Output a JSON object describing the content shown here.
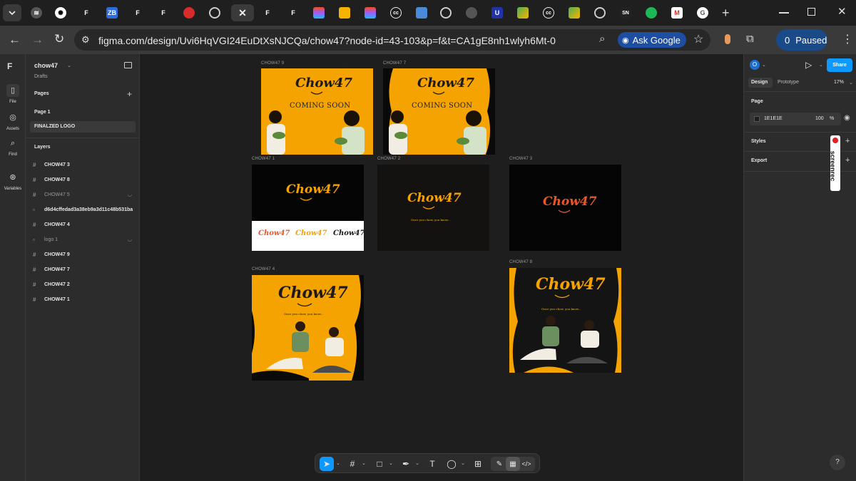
{
  "browser": {
    "url": "figma.com/design/Uvi6HqVGI24EuDtXsNJCQa/chow47?node-id=43-103&p=f&t=CA1gE8nh1wlyh6Mt-0",
    "ask_google_label": "Ask Google",
    "profile_initial": "0",
    "profile_status": "Paused",
    "new_tab": "+",
    "tab_texts": {
      "sn": "SN",
      "u": "U",
      "g": "G"
    }
  },
  "rail": {
    "file_label": "File",
    "assets_label": "Assets",
    "find_label": "Find",
    "variables_label": "Variables"
  },
  "file": {
    "name": "chow47",
    "location": "Drafts"
  },
  "pages": {
    "heading": "Pages",
    "items": [
      "Page 1",
      "FINALZED LOGO"
    ],
    "selected": "FINALZED LOGO"
  },
  "layers": {
    "heading": "Layers",
    "items": [
      {
        "name": "CHOW47 3",
        "icon": "frame-icon",
        "dim": false
      },
      {
        "name": "CHOW47 8",
        "icon": "frame-icon",
        "dim": false
      },
      {
        "name": "CHOW47 5",
        "icon": "frame-icon",
        "dim": true
      },
      {
        "name": "d6d4cffedad3a38eb9a3d11c48b531ba",
        "icon": "image-icon",
        "dim": false
      },
      {
        "name": "CHOW47 4",
        "icon": "frame-icon",
        "dim": false
      },
      {
        "name": "logo 1",
        "icon": "image-icon",
        "dim": true
      },
      {
        "name": "CHOW47 9",
        "icon": "frame-icon",
        "dim": false
      },
      {
        "name": "CHOW47 7",
        "icon": "frame-icon",
        "dim": false
      },
      {
        "name": "CHOW47 2",
        "icon": "frame-icon",
        "dim": false
      },
      {
        "name": "CHOW47 1",
        "icon": "frame-icon",
        "dim": false
      }
    ]
  },
  "canvas": {
    "frames": {
      "f9": {
        "label": "CHOW47 9",
        "logo": "Chow47",
        "subtitle": "COMING SOON"
      },
      "f7": {
        "label": "CHOW47 7",
        "logo": "Chow47",
        "subtitle": "COMING SOON"
      },
      "f1": {
        "label": "CHOW47 1",
        "logo": "Chow47",
        "variants": [
          "Chow47",
          "Chow47",
          "Chow47"
        ]
      },
      "f2": {
        "label": "CHOW47 2",
        "logo": "Chow47",
        "tagline": "Once you chow, you know..."
      },
      "f3": {
        "label": "CHOW47 3",
        "logo": "Chow47"
      },
      "f4": {
        "label": "CHOW47 4",
        "logo": "Chow47",
        "tagline": "Once you chow, you know..."
      },
      "f8": {
        "label": "CHOW47 8",
        "logo": "Chow47",
        "tagline": "Once you chow, you know..."
      }
    }
  },
  "props": {
    "avatar_initial": "O",
    "share_label": "Share",
    "tabs": [
      "Design",
      "Prototype"
    ],
    "zoom": "17%",
    "page_heading": "Page",
    "page_color": "1E1E1E",
    "page_opacity": "100",
    "percent_sign": "%",
    "styles_label": "Styles",
    "export_label": "Export",
    "screenrec": "screenrec",
    "help": "?"
  },
  "colors": {
    "accent": "#0d99ff",
    "brand_orange": "#f5a300",
    "dark_frame": "#0a0a0a"
  }
}
